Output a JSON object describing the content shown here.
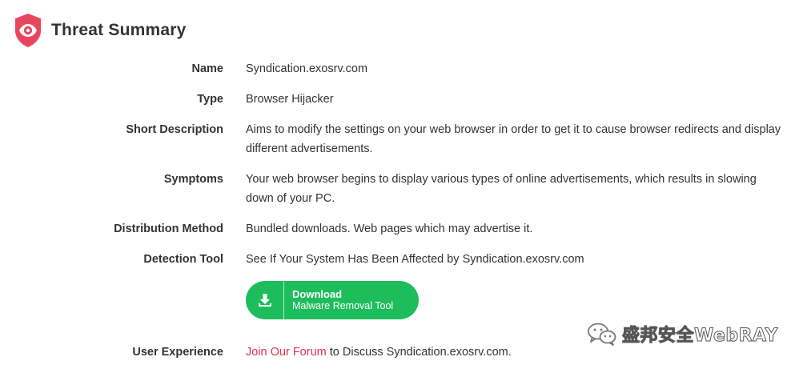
{
  "header": {
    "title": "Threat Summary",
    "icon": "eye-shield-icon",
    "accent_color": "#e8465c"
  },
  "rows": [
    {
      "label": "Name",
      "value": "Syndication.exosrv.com"
    },
    {
      "label": "Type",
      "value": "Browser Hijacker"
    },
    {
      "label": "Short Description",
      "value": "Aims to modify the settings on your web browser in order to get it to cause browser redirects and display different advertisements."
    },
    {
      "label": "Symptoms",
      "value": "Your web browser begins to display various types of online advertisements, which results in slowing down of your PC."
    },
    {
      "label": "Distribution Method",
      "value": "Bundled downloads. Web pages which may advertise it."
    },
    {
      "label": "Detection Tool",
      "value": "See If Your System Has Been Affected by Syndication.exosrv.com"
    },
    {
      "label": "User Experience",
      "link_text": "Join Our Forum",
      "value_suffix": " to Discuss Syndication.exosrv.com."
    }
  ],
  "download_button": {
    "line1": "Download",
    "line2": "Malware Removal Tool",
    "icon": "download-icon",
    "color": "#1dbd5c"
  },
  "watermark": {
    "icon": "wechat-icon",
    "text": "盛邦安全WebRAY"
  }
}
